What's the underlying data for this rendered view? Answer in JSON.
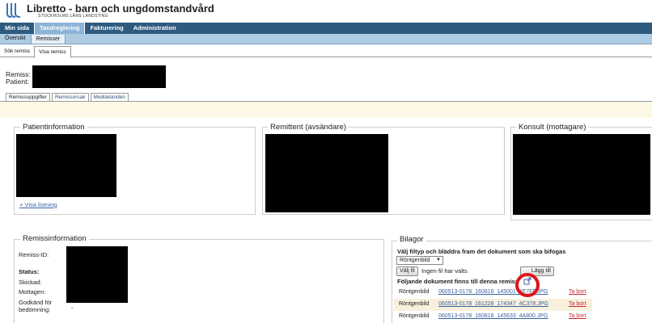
{
  "header": {
    "title": "Libretto - barn och ungdomstandvård",
    "subtitle": "STOCKHOLMS LÄNS LANDSTING"
  },
  "main_nav": [
    {
      "label": "Min sida"
    },
    {
      "label": "Tandreglering"
    },
    {
      "label": "Fakturering"
    },
    {
      "label": "Administration"
    }
  ],
  "sub_nav": [
    {
      "label": "Översikt"
    },
    {
      "label": "Remisser"
    }
  ],
  "third_nav": [
    {
      "label": "Sök remiss"
    },
    {
      "label": "Visa remiss"
    }
  ],
  "remiss_header": {
    "remiss_label": "Remiss:",
    "patient_label": "Patient:"
  },
  "detail_tabs": [
    {
      "label": "Remissuppgifter"
    },
    {
      "label": "Remissorsak"
    },
    {
      "label": "Meddelanden"
    }
  ],
  "patient": {
    "legend": "Patientinformation",
    "show_list_link": "+ Visa listning"
  },
  "remittent": {
    "legend": "Remittent (avsändare)"
  },
  "konsult": {
    "legend": "Konsult (mottagare)"
  },
  "remissinfo": {
    "legend": "Remissinformation",
    "remiss_id_label": "Remiss-ID:",
    "status_label": "Status:",
    "skickad_label": "Skickad:",
    "mottagen_label": "Mottagen:",
    "godkand_label_1": "Godkänd för",
    "godkand_label_2": "bedömning:",
    "godkand_value": "-"
  },
  "bilagor": {
    "legend": "Bilagor",
    "instruction": "Välj filtyp och bläddra fram det dokument som ska bifogas",
    "filetype_selected": "Röntgenbild",
    "choose_file_button": "Välj fil",
    "no_file_text": "Ingen fil har valts",
    "add_button": "Lägg till",
    "existing_docs_text": "Följande dokument finns till denna remiss",
    "delete_label": "Ta bort",
    "files": [
      {
        "type": "Röntgenbild",
        "name": "060513-0178_160816_145001_4E7FF.JPG"
      },
      {
        "type": "Röntgenbild",
        "name": "060513-0178_161228_174347_4C378.JPG"
      },
      {
        "type": "Röntgenbild",
        "name": "060513-0178_160816_145633_4A800.JPG"
      }
    ]
  },
  "colors": {
    "nav_bg": "#2e5a7e",
    "subnav_bg": "#aecbe4",
    "highlight_circle": "#e1141b",
    "delete_link": "#c4262e"
  }
}
